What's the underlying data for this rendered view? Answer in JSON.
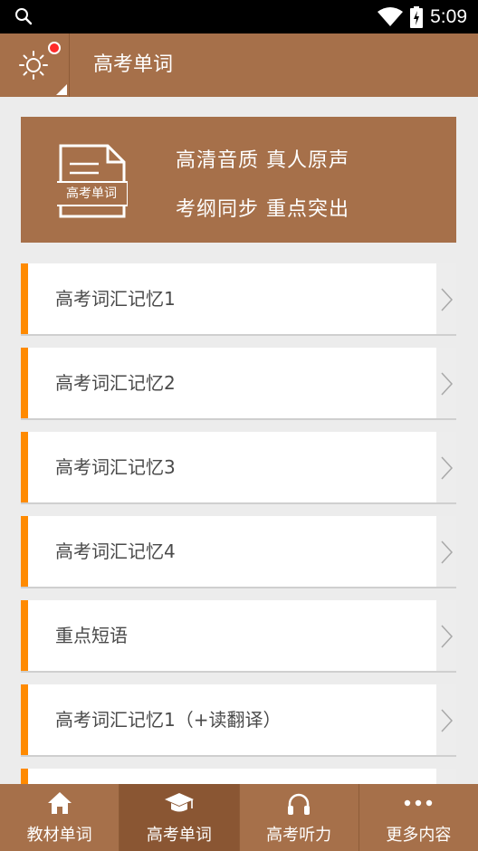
{
  "status_bar": {
    "time": "5:09"
  },
  "app_bar": {
    "title": "高考单词"
  },
  "banner": {
    "doc_label": "高考单词",
    "line1": "高清音质 真人原声",
    "line2": "考纲同步 重点突出"
  },
  "list": {
    "items": [
      {
        "label": "高考词汇记忆1"
      },
      {
        "label": "高考词汇记忆2"
      },
      {
        "label": "高考词汇记忆3"
      },
      {
        "label": "高考词汇记忆4"
      },
      {
        "label": "重点短语"
      },
      {
        "label": "高考词汇记忆1（+读翻译）"
      }
    ]
  },
  "bottom_nav": {
    "tabs": [
      {
        "label": "教材单词",
        "icon": "home-icon",
        "active": false
      },
      {
        "label": "高考单词",
        "icon": "graduation-cap-icon",
        "active": true
      },
      {
        "label": "高考听力",
        "icon": "headphones-icon",
        "active": false
      },
      {
        "label": "更多内容",
        "icon": "more-dots-icon",
        "active": false
      }
    ]
  },
  "colors": {
    "brand": "#a6704a",
    "accent": "#ff8a00",
    "active_tab": "#8a5633"
  }
}
